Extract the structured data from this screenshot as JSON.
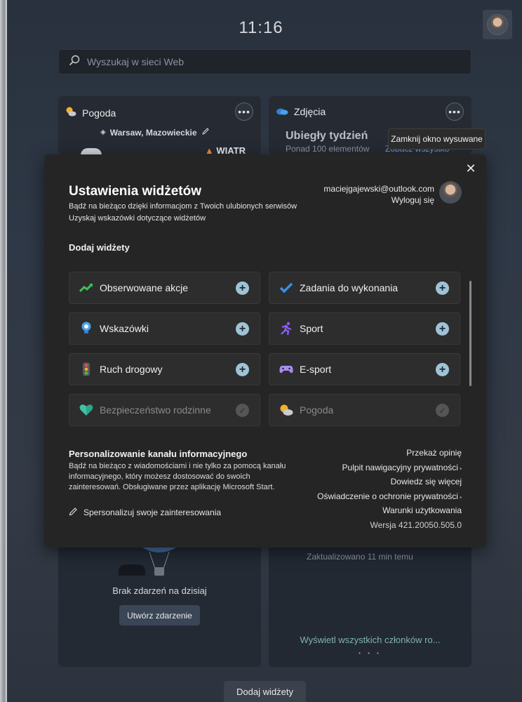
{
  "board": {
    "time": "11:16",
    "search_placeholder": "Wyszukaj w sieci Web",
    "weather_card": {
      "title": "Pogoda",
      "location": "Warsaw, Mazowieckie",
      "wind": "WIATR"
    },
    "photos_card": {
      "title": "Zdjęcia",
      "heading": "Ubiegły tydzień",
      "subtitle": "Ponad 100 elementów",
      "link": "Zobacz wszystko"
    },
    "tooltip": "Zamknij okno wysuwane",
    "calendar_card": {
      "no_events": "Brak zdarzeń na dzisiaj",
      "create_button": "Utwórz zdarzenie"
    },
    "family_card": {
      "updated": "Zaktualizowano 11 min temu",
      "members_link": "Wyświetl wszystkich członków ro...",
      "dots": "• • •"
    },
    "add_widgets_button": "Dodaj widżety"
  },
  "modal": {
    "close": "✕",
    "title": "Ustawienia widżetów",
    "subtitle": "Bądź na bieżąco dzięki informacjom z Twoich ulubionych serwisów",
    "tips_link": "Uzyskaj wskazówki dotyczące widżetów",
    "account_email": "maciejgajewski@outlook.com",
    "logout": "Wyloguj się",
    "add_section_heading": "Dodaj widżety",
    "widgets": [
      {
        "label": "Obserwowane akcje",
        "icon": "stocks-icon",
        "color": "#3fbf5a",
        "added": false
      },
      {
        "label": "Zadania do wykonania",
        "icon": "todo-check-icon",
        "color": "#3b8fe0",
        "added": false
      },
      {
        "label": "Wskazówki",
        "icon": "tips-bulb-icon",
        "color": "#4aa3e8",
        "added": false
      },
      {
        "label": "Sport",
        "icon": "sport-runner-icon",
        "color": "#8b5cf0",
        "added": false
      },
      {
        "label": "Ruch drogowy",
        "icon": "traffic-light-icon",
        "color": "#e0a030",
        "added": false
      },
      {
        "label": "E-sport",
        "icon": "gamepad-icon",
        "color": "#a88cf0",
        "added": false
      },
      {
        "label": "Bezpieczeństwo rodzinne",
        "icon": "family-heart-icon",
        "color": "#2fa58a",
        "added": true
      },
      {
        "label": "Pogoda",
        "icon": "weather-sun-icon",
        "color": "#f0b030",
        "added": true
      }
    ],
    "feed": {
      "heading": "Personalizowanie kanału informacyjnego",
      "description": "Bądź na bieżąco z wiadomościami i nie tylko za pomocą kanału informacyjnego, który możesz dostosować do swoich zainteresowań. Obsługiwane przez aplikację Microsoft Start.",
      "personalize_link": "Spersonalizuj swoje zainteresowania"
    },
    "links": {
      "feedback": "Przekaż opinię",
      "privacy_dashboard": "Pulpit nawigacyjny prywatności",
      "learn_more": "Dowiedz się więcej",
      "privacy_statement": "Oświadczenie o ochronie prywatności",
      "terms": "Warunki użytkowania",
      "version": "Wersja 421.20050.505.0"
    }
  }
}
